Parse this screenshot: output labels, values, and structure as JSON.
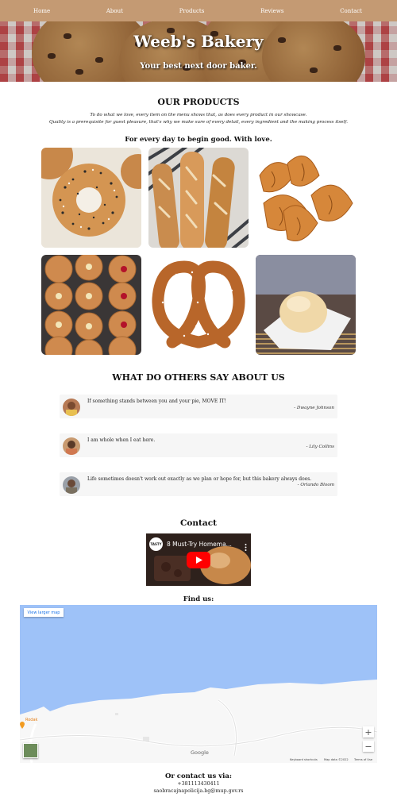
{
  "nav": {
    "items": [
      {
        "label": "Home"
      },
      {
        "label": "About"
      },
      {
        "label": "Products"
      },
      {
        "label": "Reviews"
      },
      {
        "label": "Contact"
      }
    ]
  },
  "hero": {
    "title": "Weeb's Bakery",
    "subtitle": "Your best next door baker."
  },
  "products": {
    "heading": "OUR PRODUCTS",
    "intro_line1": "To do what we love, every item on the menu shows that, as does every product in our showcase.",
    "intro_line2": "Quality is a prerequisite for guest pleasure, that's why we make sure of every detail, every ingredient and the making process itself.",
    "tagline": "For every day to begin good. With love.",
    "items": [
      {
        "name": "bagel"
      },
      {
        "name": "baguettes"
      },
      {
        "name": "croissants"
      },
      {
        "name": "donuts"
      },
      {
        "name": "pretzel"
      },
      {
        "name": "bread-roll"
      }
    ]
  },
  "reviews": {
    "heading": "WHAT DO OTHERS SAY ABOUT US",
    "items": [
      {
        "quote": "If something stands between you and your pie, MOVE IT!",
        "author": "- Dwayne Johnson"
      },
      {
        "quote": "I am whole when I eat here.",
        "author": "- Lily Collins"
      },
      {
        "quote": "Life sometimes doesn't work out exactly as we plan or hope for, but this bakery always does.",
        "author": "- Orlando Bloom"
      }
    ]
  },
  "contact": {
    "heading": "Contact",
    "video_channel": "TASTY",
    "video_title": "8 Must-Try Homema...",
    "find_heading": "Find us:",
    "map_button": "View larger map",
    "map_place": "Rodak",
    "map_brand": "Google",
    "map_footer": [
      "Keyboard shortcuts",
      "Map data ©2022",
      "Terms of Use"
    ],
    "via_heading": "Or contact us via:",
    "phone": "+381113430411",
    "email": "saobracajnapolicija.bg@mup.gov.rs"
  },
  "colors": {
    "nav_bg": "#c49a73",
    "map_water": "#9ec2f8",
    "youtube_red": "#ff0000"
  }
}
